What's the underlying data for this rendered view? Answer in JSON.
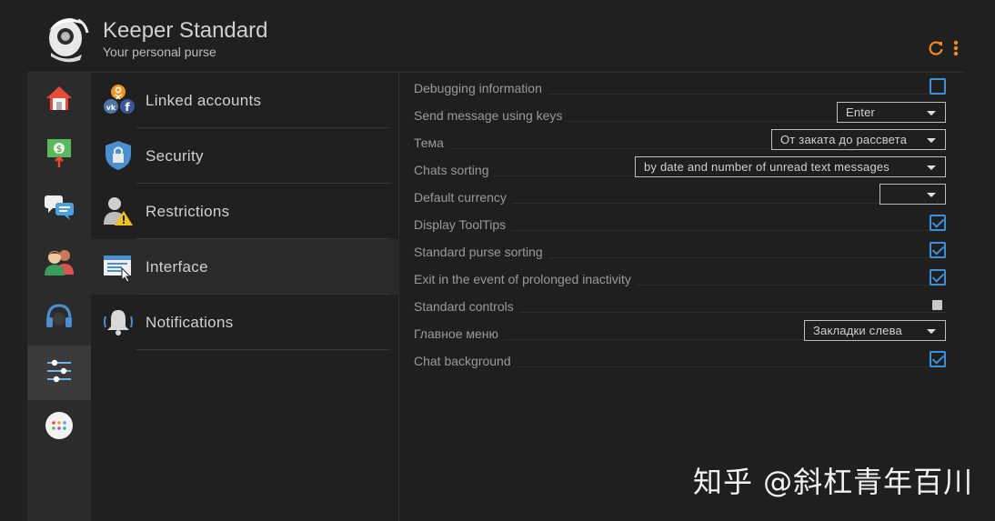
{
  "header": {
    "title": "Keeper Standard",
    "subtitle": "Your personal purse",
    "accent": "#f28a1e"
  },
  "rail": {
    "items": [
      {
        "icon": "home-icon"
      },
      {
        "icon": "money-transfer-icon"
      },
      {
        "icon": "chat-icon"
      },
      {
        "icon": "contacts-icon"
      },
      {
        "icon": "headset-icon"
      },
      {
        "icon": "settings-sliders-icon",
        "active": true
      },
      {
        "icon": "apps-icon"
      }
    ]
  },
  "menu": {
    "items": [
      {
        "label": "Linked accounts",
        "icon": "linked-accounts-icon"
      },
      {
        "label": "Security",
        "icon": "shield-lock-icon"
      },
      {
        "label": "Restrictions",
        "icon": "user-warning-icon"
      },
      {
        "label": "Interface",
        "icon": "window-cursor-icon",
        "active": true
      },
      {
        "label": "Notifications",
        "icon": "bell-icon"
      }
    ]
  },
  "settings": {
    "rows": [
      {
        "label": "Debugging information",
        "type": "checkbox",
        "checked": false
      },
      {
        "label": "Send message using keys",
        "type": "select",
        "value": "Enter"
      },
      {
        "label": "Тема",
        "type": "select",
        "value": "От заката до рассвета"
      },
      {
        "label": "Chats sorting",
        "type": "select",
        "value": "by date and number of unread text messages"
      },
      {
        "label": "Default currency",
        "type": "select",
        "value": ""
      },
      {
        "label": "Display ToolTips",
        "type": "checkbox",
        "checked": true
      },
      {
        "label": "Standard purse sorting",
        "type": "checkbox",
        "checked": true
      },
      {
        "label": "Exit in the event of prolonged inactivity",
        "type": "checkbox",
        "checked": true
      },
      {
        "label": "Standard controls",
        "type": "checkbox-small",
        "checked": false
      },
      {
        "label": "Главное меню",
        "type": "select",
        "value": "Закладки слева"
      },
      {
        "label": "Chat background",
        "type": "checkbox",
        "checked": true
      }
    ]
  },
  "watermark": "知乎 @斜杠青年百川"
}
